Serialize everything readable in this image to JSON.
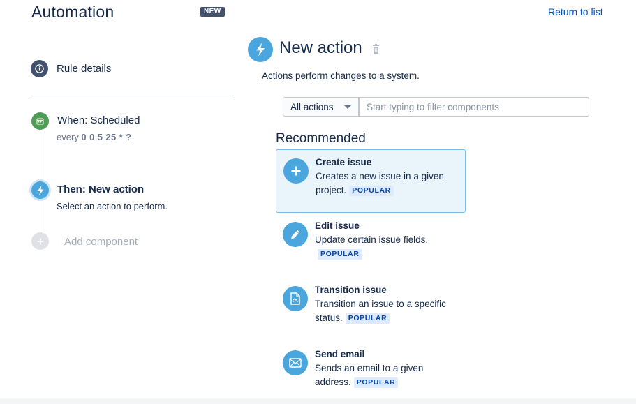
{
  "header": {
    "title": "Automation",
    "badge": "NEW",
    "return_link": "Return to list"
  },
  "rule_details": {
    "label": "Rule details",
    "icon": "info-icon"
  },
  "steps": {
    "when": {
      "title": "When: Scheduled",
      "prefix": "every",
      "cron": "0 0 5 25 * ?",
      "icon": "calendar-icon",
      "color": "#4c9e54"
    },
    "then": {
      "title": "Then: New action",
      "subtitle": "Select an action to perform.",
      "icon": "lightning-icon",
      "color": "#4aa6dc"
    },
    "add": {
      "label": "Add component",
      "icon": "plus-icon"
    }
  },
  "main": {
    "title": "New action",
    "description": "Actions perform changes to a system.",
    "filter": {
      "selected": "All actions",
      "placeholder": "Start typing to filter components"
    },
    "section_title": "Recommended",
    "badge_text": "POPULAR",
    "cards": [
      {
        "title": "Create issue",
        "description": "Creates a new issue in a given project.",
        "icon": "plus-icon"
      },
      {
        "title": "Edit issue",
        "description": "Update certain issue fields.",
        "icon": "pencil-icon"
      },
      {
        "title": "Transition issue",
        "description": "Transition an issue to a specific status.",
        "icon": "transition-document-icon"
      },
      {
        "title": "Send email",
        "description": "Sends an email to a given address.",
        "icon": "envelope-icon"
      }
    ]
  },
  "colors": {
    "accent": "#4aa6dc",
    "link": "#0052cc",
    "selected_card_bg": "#e9f4fb",
    "badge_bg": "#deebff"
  }
}
